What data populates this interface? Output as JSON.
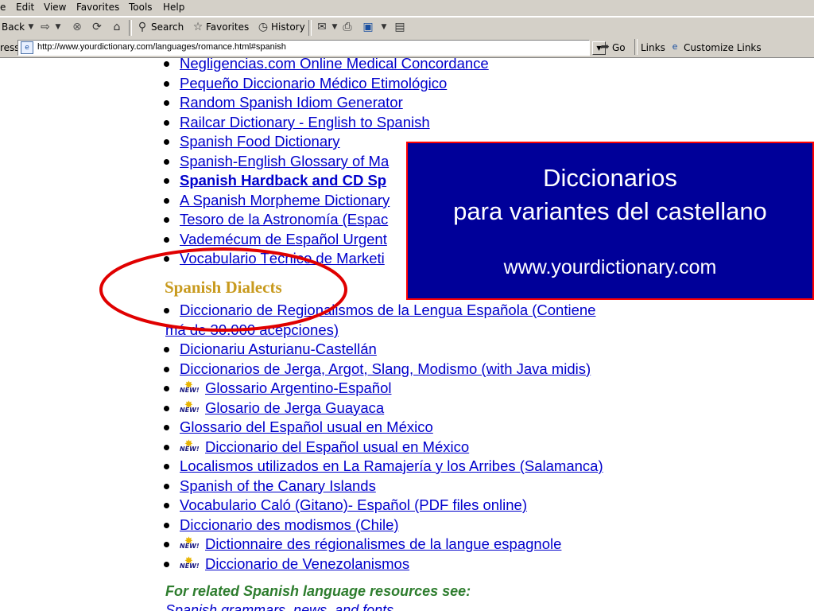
{
  "menu": [
    "e",
    "Edit",
    "View",
    "Favorites",
    "Tools",
    "Help"
  ],
  "toolbar": {
    "back_label": "Back",
    "search_label": "Search",
    "favorites_label": "Favorites",
    "history_label": "History"
  },
  "address": {
    "label": "ress",
    "url": "http://www.yourdictionary.com/languages/romance.html#spanish",
    "go_label": "Go",
    "links_label": "Links",
    "customize_label": "Customize Links"
  },
  "spanish_links": [
    {
      "text": "Negligencias.com Online Medical Concordance",
      "new": false,
      "bold": false
    },
    {
      "text": "Pequeño Diccionario Médico Etimológico",
      "new": false,
      "bold": false
    },
    {
      "text": "Random Spanish Idiom Generator",
      "new": false,
      "bold": false
    },
    {
      "text": "Railcar Dictionary - English to Spanish",
      "new": false,
      "bold": false
    },
    {
      "text": "Spanish Food Dictionary",
      "new": false,
      "bold": false
    },
    {
      "text": "Spanish-English Glossary of Ma",
      "new": false,
      "bold": false
    },
    {
      "text": "Spanish Hardback and CD Sp",
      "new": false,
      "bold": true
    },
    {
      "text": "A Spanish Morpheme Dictionary",
      "new": false,
      "bold": false
    },
    {
      "text": "Tesoro de la Astronomía (Espac",
      "new": false,
      "bold": false
    },
    {
      "text": "Vademécum de Español Urgent",
      "new": false,
      "bold": false
    },
    {
      "text": "Vocabulario Técnico de Marketi",
      "new": false,
      "bold": false
    }
  ],
  "dialects_title": "Spanish Dialects",
  "dialect_first": {
    "line1": "Diccionario de Regionalismos de la Lengua Española (Contiene",
    "line2": "má de 30.000 acepciones)"
  },
  "dialect_links": [
    {
      "text": "Dicionariu Asturianu-Castellán",
      "new": false
    },
    {
      "text": "Diccionarios de Jerga, Argot, Slang, Modismo (with Java midis)",
      "new": false
    },
    {
      "text": "Glossario Argentino-Español",
      "new": true
    },
    {
      "text": "Glosario de Jerga Guayaca",
      "new": true
    },
    {
      "text": "Glossario del Español usual en México",
      "new": false
    },
    {
      "text": "Diccionario del Español usual en México",
      "new": true
    },
    {
      "text": "Localismos utilizados en La Ramajería y los Arribes (Salamanca)",
      "new": false
    },
    {
      "text": "Spanish of the Canary Islands",
      "new": false
    },
    {
      "text": "Vocabulario Caló (Gitano)- Español (PDF files online)",
      "new": false
    },
    {
      "text": "Diccionario des modismos (Chile)",
      "new": false
    },
    {
      "text": "Dictionnaire des régionalismes de la langue espagnole",
      "new": true
    },
    {
      "text": "Diccionario de Venezolanismos",
      "new": true
    }
  ],
  "new_badge_label": "NEW!",
  "related_heading": "For related Spanish language resources see:",
  "related_link": "Spanish grammars, news, and fonts",
  "overlay": {
    "line1": "Diccionarios",
    "line2": "para variantes del castellano",
    "line3": "www.yourdictionary.com"
  },
  "colors": {
    "overlay_bg": "#000099",
    "overlay_border": "#ff0000",
    "link": "#0000cc",
    "section_title": "#c89a1e",
    "related_heading": "#2e7d2e",
    "highlight_ellipse": "#e00000"
  }
}
